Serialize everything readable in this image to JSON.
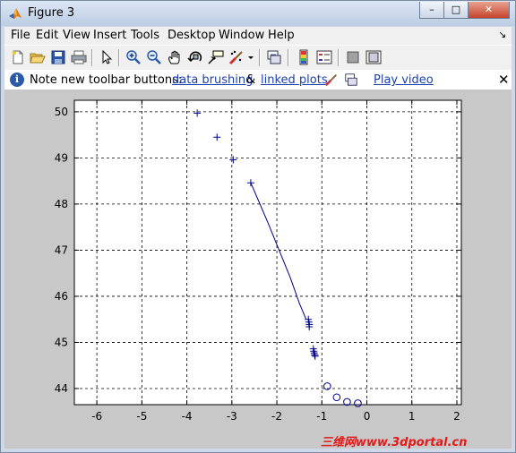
{
  "window": {
    "title": "Figure 3",
    "controls": {
      "minimize": "–",
      "maximize": "□",
      "close": "✕"
    }
  },
  "menubar": {
    "items": [
      "File",
      "Edit",
      "View",
      "Insert",
      "Tools",
      "Desktop",
      "Window",
      "Help"
    ],
    "dock_glyph": "↘"
  },
  "toolbar": {
    "icons": [
      "new-figure-icon",
      "open-file-icon",
      "save-figure-icon",
      "print-figure-icon",
      "edit-plot-arrow-icon",
      "zoom-in-icon",
      "zoom-out-icon",
      "pan-hand-icon",
      "rotate-3d-icon",
      "data-cursor-icon",
      "brush-data-icon",
      "brush-dropdown-icon",
      "link-plot-icon",
      "insert-colorbar-icon",
      "insert-legend-icon",
      "hide-plot-tools-icon",
      "show-plot-tools-icon"
    ]
  },
  "infobar": {
    "prefix": "Note new toolbar buttons: ",
    "link1": "data brushing",
    "amp": " & ",
    "link2": "linked plots",
    "video": "Play video",
    "close": "✕"
  },
  "watermark": "三维网www.3dportal.cn",
  "chart_data": {
    "type": "line",
    "title": "",
    "xlabel": "",
    "ylabel": "",
    "xlim": [
      -6.5,
      2.1
    ],
    "ylim": [
      43.65,
      50.25
    ],
    "xticks": [
      -6,
      -5,
      -4,
      -3,
      -2,
      -1,
      0,
      1,
      2
    ],
    "yticks": [
      44,
      45,
      46,
      47,
      48,
      49,
      50
    ],
    "grid": true,
    "grid_style": "dashed",
    "colors": {
      "series": "#00008b",
      "axes_bg": "#ffffff",
      "figure_bg": "#c8c8c8"
    },
    "series": [
      {
        "marker": "+",
        "line": false,
        "points": [
          [
            -3.77,
            49.97
          ],
          [
            -3.33,
            49.45
          ],
          [
            -2.97,
            48.96
          ]
        ]
      },
      {
        "marker": "+",
        "line": true,
        "points": [
          [
            -2.58,
            48.46
          ],
          [
            -2.42,
            48.1
          ],
          [
            -2.2,
            47.6
          ],
          [
            -1.95,
            47.0
          ],
          [
            -1.7,
            46.4
          ],
          [
            -1.5,
            45.85
          ],
          [
            -1.35,
            45.5
          ]
        ]
      },
      {
        "marker": "+",
        "line": false,
        "points": [
          [
            -1.3,
            45.5
          ],
          [
            -1.29,
            45.44
          ],
          [
            -1.28,
            45.39
          ],
          [
            -1.28,
            45.34
          ]
        ]
      },
      {
        "marker": "+",
        "line": false,
        "points": [
          [
            -1.19,
            44.86
          ],
          [
            -1.18,
            44.81
          ],
          [
            -1.17,
            44.77
          ],
          [
            -1.16,
            44.73
          ],
          [
            -1.15,
            44.7
          ]
        ]
      },
      {
        "marker": "o",
        "line": false,
        "points": [
          [
            -0.88,
            44.05
          ],
          [
            -0.67,
            43.81
          ],
          [
            -0.44,
            43.71
          ],
          [
            -0.2,
            43.68
          ]
        ]
      }
    ]
  }
}
